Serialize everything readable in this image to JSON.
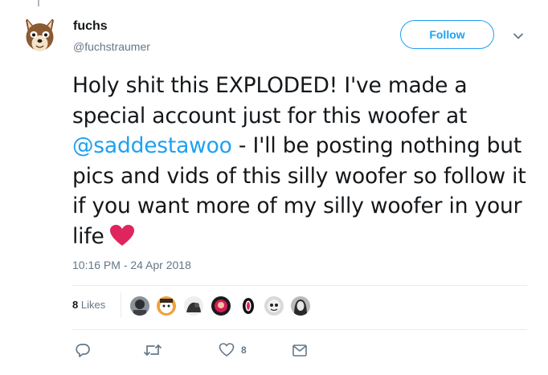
{
  "tweet": {
    "author_name": "fuchs",
    "author_handle": "@fuchstraumer",
    "follow_label": "Follow",
    "text_lines": {
      "part1": "Holy shit this EXPLODED! I've made a special account just for this woofer at ",
      "mention": "@saddestawoo",
      "part2": " - I'll be posting nothing but pics and vids of this silly woofer so follow it if you want more of my silly woofer in your life"
    },
    "timestamp": "10:16 PM - 24 Apr 2018",
    "likes_count": "8",
    "likes_label": "Likes",
    "like_action_count": "8"
  },
  "colors": {
    "accent": "#1da1f2",
    "heart": "#e0245e",
    "muted": "#657786",
    "divider": "#e6ecf0"
  },
  "icons": {
    "reply": "reply-icon",
    "retweet": "retweet-icon",
    "like": "heart-icon",
    "dm": "envelope-icon",
    "caret": "chevron-down-icon"
  }
}
